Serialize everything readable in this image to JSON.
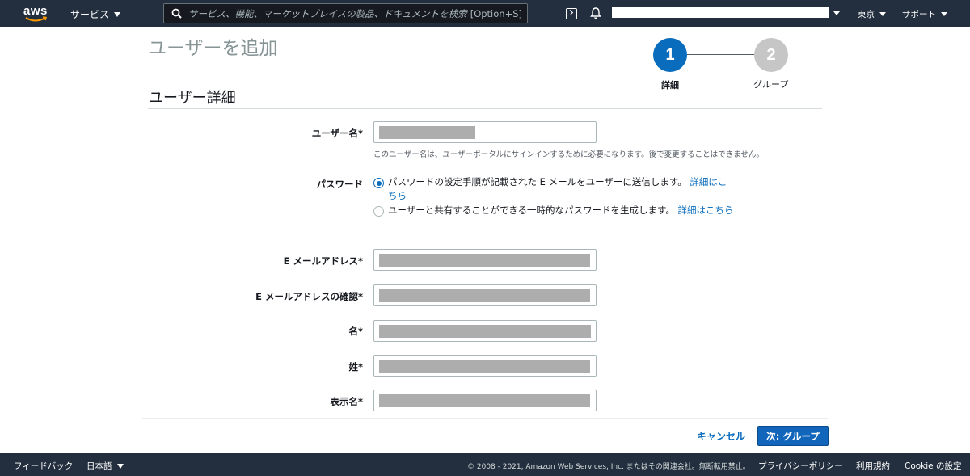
{
  "nav": {
    "logo": "aws",
    "services_label": "サービス",
    "search_placeholder": "サービス、機能、マーケットプレイスの製品、ドキュメントを検索",
    "search_shortcut": "[Option+S]",
    "region_label": "東京",
    "support_label": "サポート"
  },
  "page": {
    "title": "ユーザーを追加",
    "section_title": "ユーザー詳細"
  },
  "stepper": {
    "steps": [
      {
        "number": "1",
        "label": "詳細",
        "active": true
      },
      {
        "number": "2",
        "label": "グループ",
        "active": false
      }
    ]
  },
  "form": {
    "username_label": "ユーザー名*",
    "username_hint": "このユーザー名は、ユーザーポータルにサインインするために必要になります。後で変更することはできません。",
    "password_label": "パスワード",
    "password_options": [
      {
        "text": "パスワードの設定手順が記載された E メールをユーザーに送信します。",
        "link": "詳細はこちら",
        "selected": true
      },
      {
        "text": "ユーザーと共有することができる一時的なパスワードを生成します。",
        "link": "詳細はこちら",
        "selected": false
      }
    ],
    "email_label": "E メールアドレス*",
    "email_confirm_label": "E メールアドレスの確認*",
    "first_name_label": "名*",
    "last_name_label": "姓*",
    "display_name_label": "表示名*"
  },
  "actions": {
    "cancel_label": "キャンセル",
    "next_label": "次: グループ"
  },
  "footer": {
    "feedback": "フィードバック",
    "language": "日本語",
    "copyright": "© 2008 - 2021, Amazon Web Services, Inc. またはその関連会社。無断転用禁止。",
    "privacy": "プライバシーポリシー",
    "terms": "利用規約",
    "cookie": "Cookie の設定"
  },
  "colors": {
    "nav_bg": "#232f3e",
    "primary": "#1166bb",
    "link": "#0a6cbc",
    "step_inactive": "#c6c6c6"
  }
}
